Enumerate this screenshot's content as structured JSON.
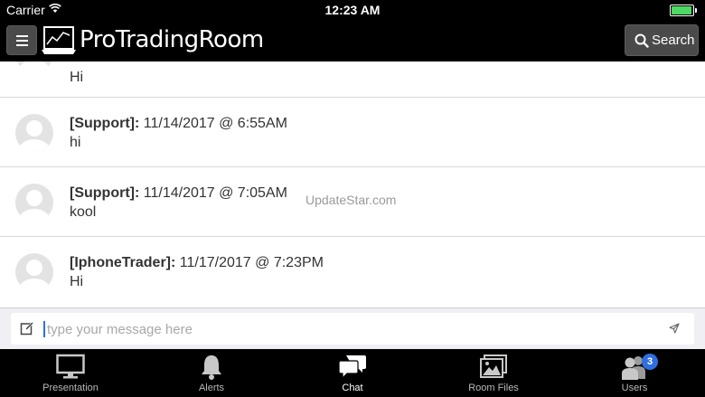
{
  "status_bar": {
    "carrier": "Carrier",
    "time": "12:23 AM",
    "battery_level": 0.95,
    "battery_color": "#4cd964"
  },
  "header": {
    "logo_text": "ProTradingRoom",
    "search_label": "Search"
  },
  "messages": [
    {
      "text": "Hi"
    },
    {
      "user": "[Support]:",
      "timestamp": "11/14/2017 @ 6:55AM",
      "text": "hi"
    },
    {
      "user": "[Support]:",
      "timestamp": "11/14/2017 @ 7:05AM",
      "text": "kool"
    },
    {
      "user": "[IphoneTrader]:",
      "timestamp": "11/17/2017 @ 7:23PM",
      "text": "Hi"
    }
  ],
  "watermark": "UpdateStar.com",
  "composer": {
    "placeholder": "type your message here",
    "value": ""
  },
  "tabs": [
    {
      "label": "Presentation",
      "icon": "monitor-icon"
    },
    {
      "label": "Alerts",
      "icon": "bell-icon"
    },
    {
      "label": "Chat",
      "icon": "chat-icon",
      "active": true
    },
    {
      "label": "Room Files",
      "icon": "images-icon"
    },
    {
      "label": "Users",
      "icon": "users-icon",
      "badge": "3"
    }
  ],
  "colors": {
    "accent": "#2f6fe0",
    "bar_bg": "#000000",
    "button_bg": "#4a4a4a"
  }
}
